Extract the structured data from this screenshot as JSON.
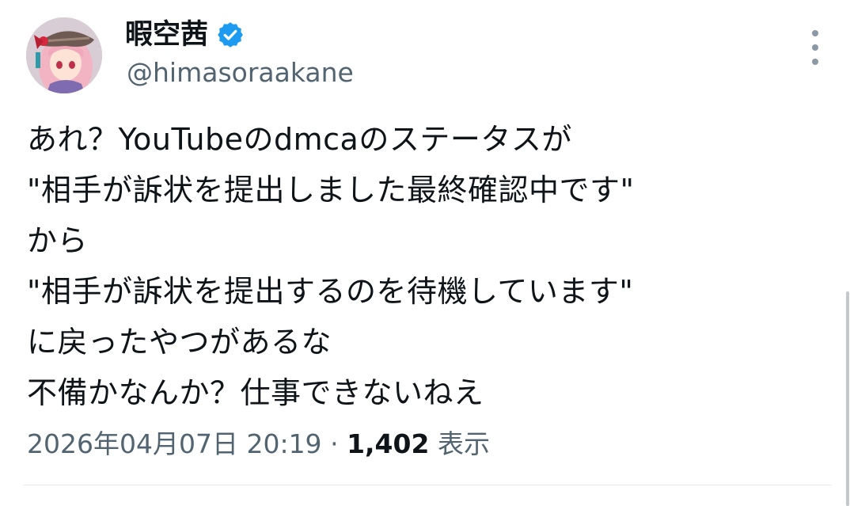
{
  "author": {
    "display_name": "暇空茜",
    "handle": "@himasoraakane",
    "verified": true,
    "avatar_icon": "avatar-anime-girl-icon",
    "verified_icon": "verified-badge-icon",
    "verified_color": "#1d9bf0"
  },
  "tweet": {
    "lines": [
      "あれ？YouTubeのdmcaのステータスが",
      "\"相手が訴状を提出しました最終確認中です\"",
      "から",
      "\"相手が訴状を提出するのを待機しています\"",
      "に戻ったやつがあるな",
      "不備かなんか？仕事できないねえ"
    ]
  },
  "meta": {
    "timestamp": "2026年04月07日 20:19",
    "separator": "·",
    "views_count": "1,402",
    "views_label": "表示"
  },
  "menu": {
    "more_icon": "more-vertical-icon"
  },
  "colors": {
    "text_primary": "#0f1419",
    "text_secondary": "#536471",
    "accent": "#1d9bf0"
  }
}
